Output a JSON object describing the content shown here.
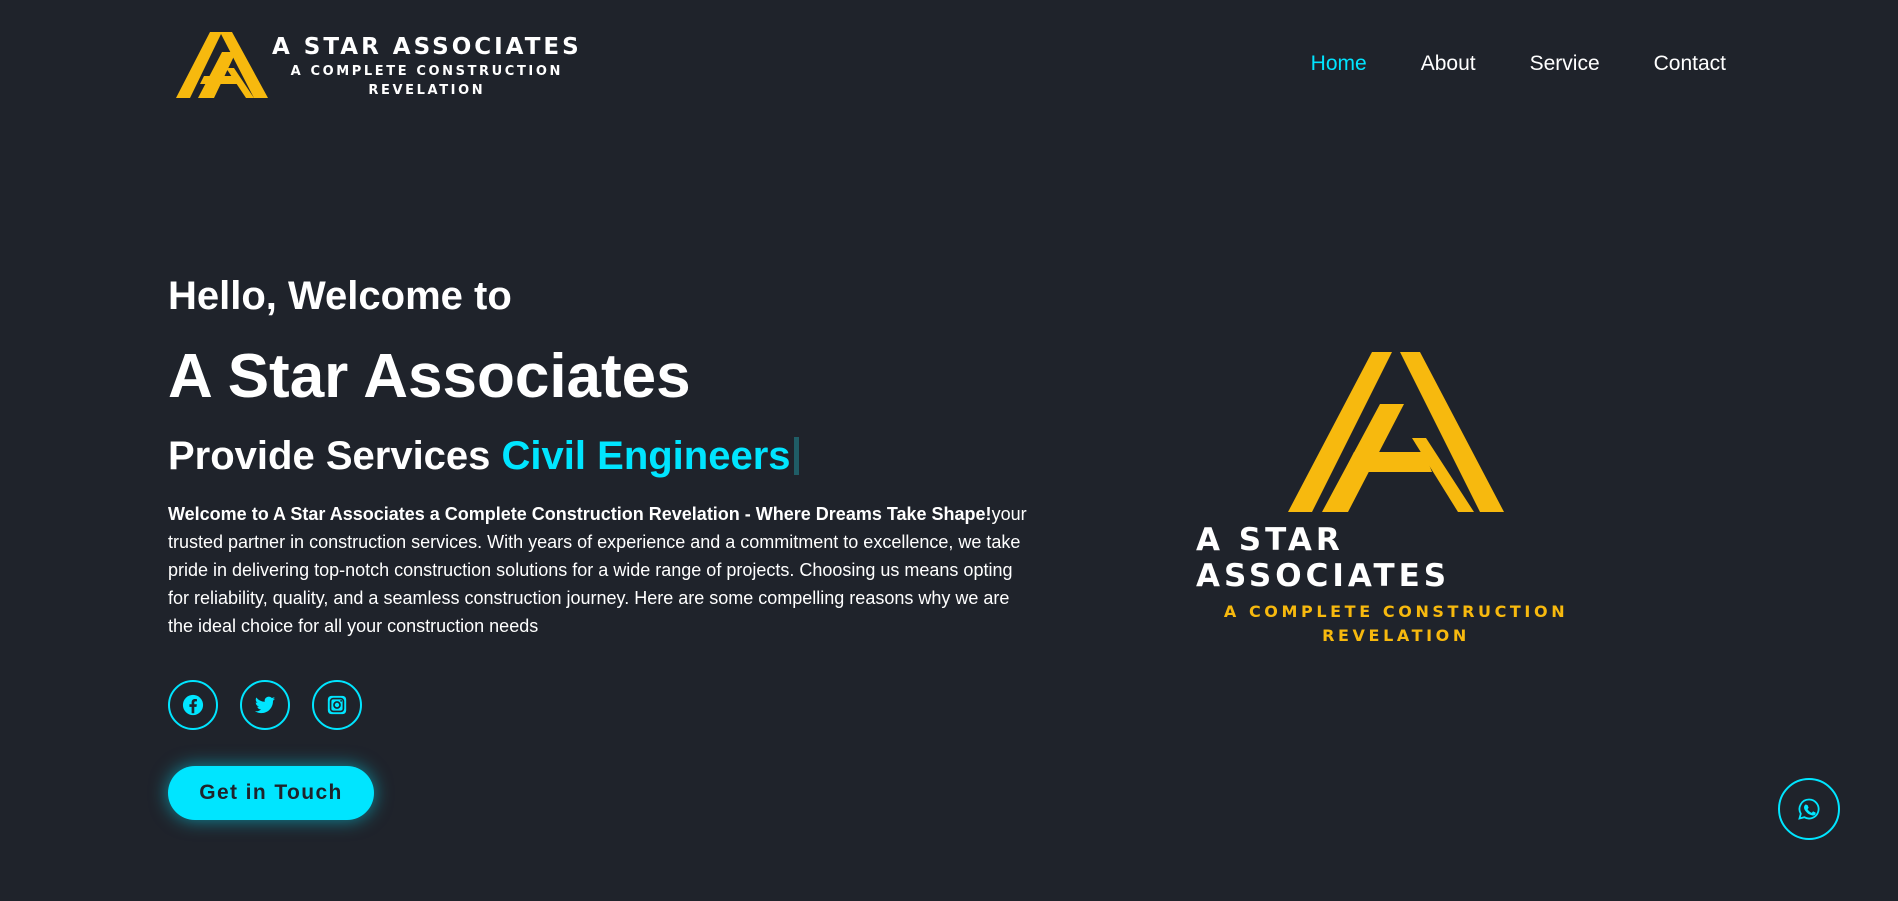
{
  "header": {
    "brand": "A STAR ASSOCIATES",
    "tagline": "A COMPLETE CONSTRUCTION REVELATION",
    "nav": [
      {
        "label": "Home",
        "active": true
      },
      {
        "label": "About",
        "active": false
      },
      {
        "label": "Service",
        "active": false
      },
      {
        "label": "Contact",
        "active": false
      }
    ]
  },
  "hero": {
    "greeting": "Hello, Welcome to",
    "title": "A Star Associates",
    "services_prefix": "Provide Services ",
    "services_highlight": "Civil Engineers",
    "intro_bold": "Welcome to A Star Associates a Complete Construction Revelation - Where Dreams Take Shape!",
    "intro_text": "your trusted partner in construction services. With years of experience and a commitment to excellence, we take pride in delivering top-notch construction solutions for a wide range of projects. Choosing us means opting for reliability, quality, and a seamless construction journey. Here are some compelling reasons why we are the ideal choice for all your construction needs",
    "socials": [
      {
        "icon": "facebook-icon"
      },
      {
        "icon": "twitter-icon"
      },
      {
        "icon": "instagram-icon"
      }
    ],
    "cta_label": "Get in Touch"
  },
  "feature_logo": {
    "brand": "A STAR ASSOCIATES",
    "tagline": "A COMPLETE CONSTRUCTION REVELATION"
  },
  "floating": {
    "icon": "whatsapp-icon"
  },
  "colors": {
    "background": "#1f232b",
    "accent": "#00e5ff",
    "logo_gold": "#f7b90e",
    "text": "#ffffff"
  }
}
